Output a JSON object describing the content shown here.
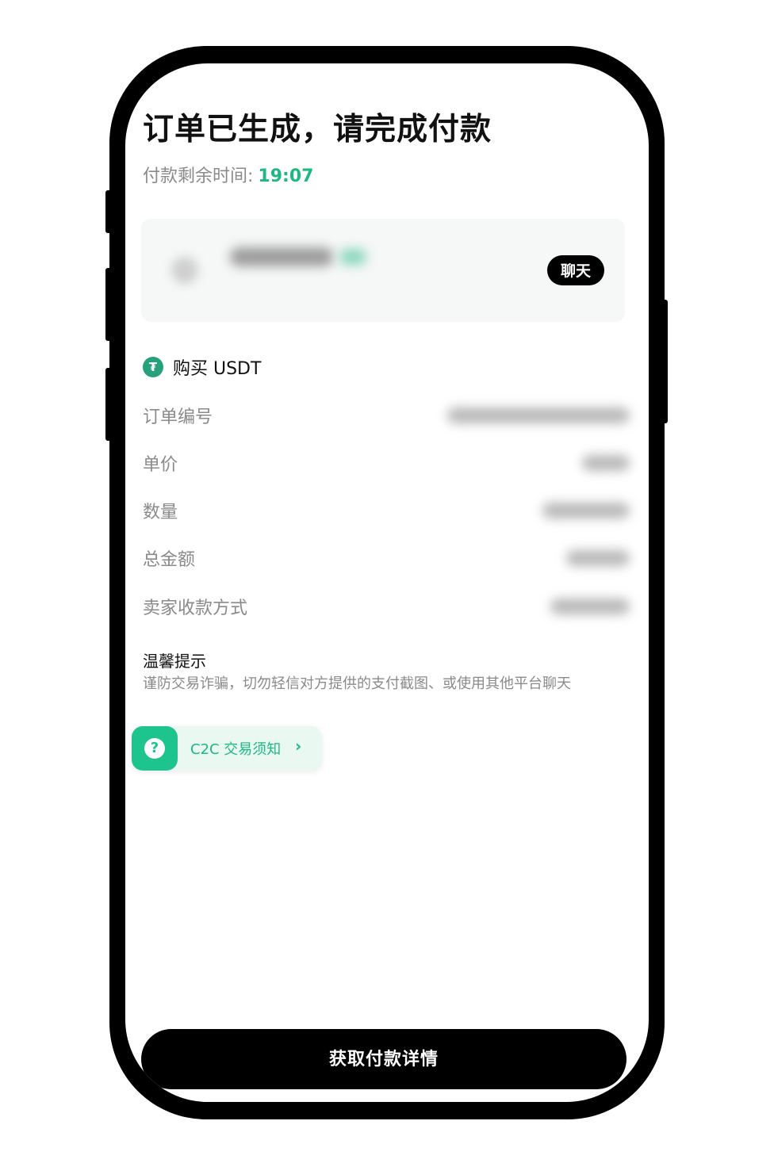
{
  "header": {
    "title": "订单已生成，请完成付款",
    "timer_label": "付款剩余时间:",
    "timer_value": "19:07"
  },
  "merchant": {
    "chat_label": "聊天"
  },
  "order": {
    "asset_icon": "tether-icon",
    "asset_label": "购买 USDT",
    "rows": [
      {
        "label": "订单编号"
      },
      {
        "label": "单价"
      },
      {
        "label": "数量"
      },
      {
        "label": "总金额"
      },
      {
        "label": "卖家收款方式"
      }
    ]
  },
  "tip": {
    "title": "温馨提示",
    "text": "谨防交易诈骗，切勿轻信对方提供的支付截图、或使用其他平台聊天"
  },
  "c2c": {
    "icon": "question-icon",
    "icon_glyph": "?",
    "label": "C2C 交易须知",
    "chevron": "›"
  },
  "footer": {
    "primary_label": "获取付款详情"
  },
  "colors": {
    "accent_green": "#1eb980",
    "tether_green": "#26a17b",
    "button_black": "#000000"
  }
}
